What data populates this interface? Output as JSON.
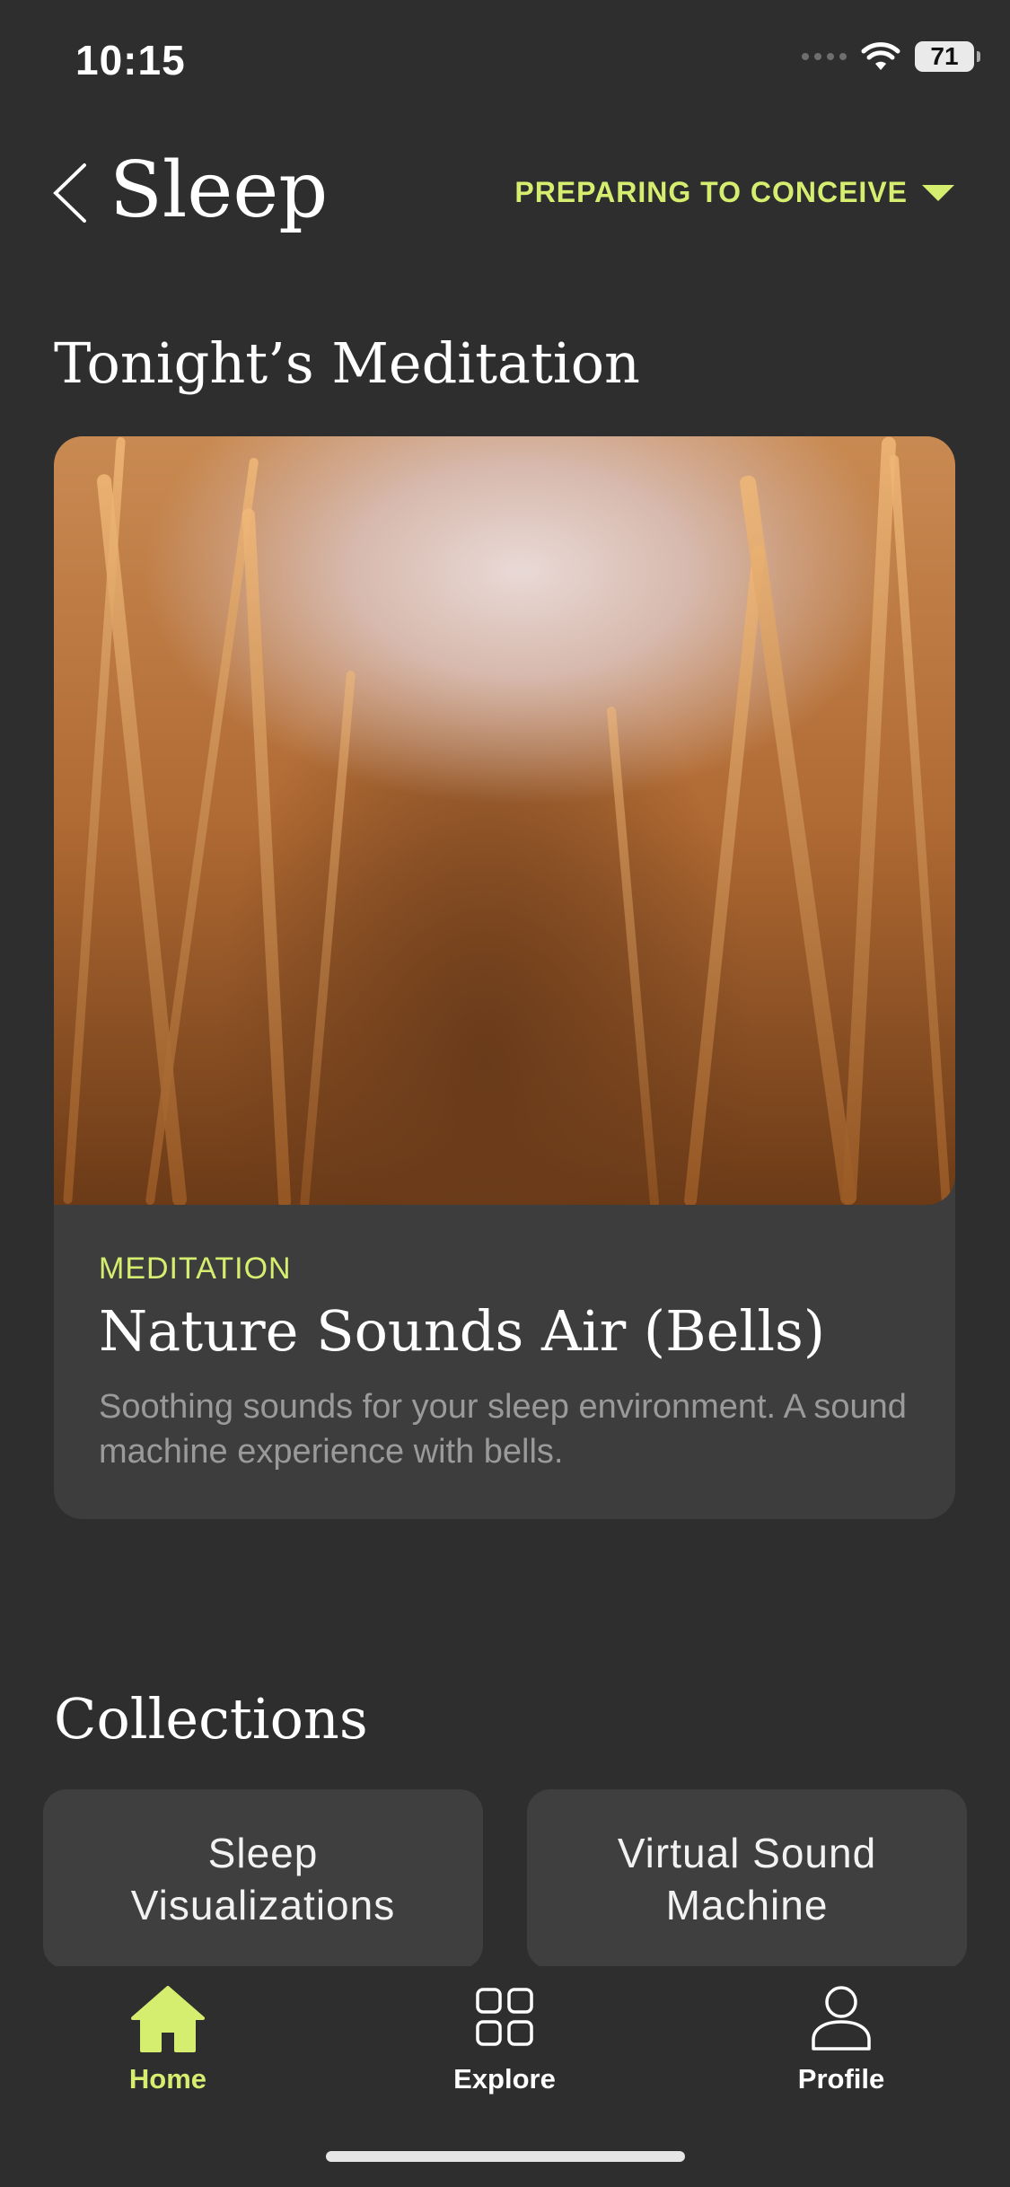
{
  "status": {
    "time": "10:15",
    "battery": "71"
  },
  "header": {
    "title": "Sleep",
    "stage": "PREPARING TO CONCEIVE"
  },
  "tonight": {
    "heading": "Tonight’s Meditation",
    "card": {
      "kind": "MEDITATION",
      "title": "Nature Sounds Air (Bells)",
      "description": "Soothing sounds for your sleep environment. A sound machine experience with bells."
    }
  },
  "collections": {
    "heading": "Collections",
    "items": [
      {
        "label": "Sleep Visualizations"
      },
      {
        "label": "Virtual Sound Machine"
      }
    ]
  },
  "tabs": [
    {
      "label": "Home",
      "icon": "home-icon",
      "active": true
    },
    {
      "label": "Explore",
      "icon": "grid-icon",
      "active": false
    },
    {
      "label": "Profile",
      "icon": "person-icon",
      "active": false
    }
  ],
  "colors": {
    "accent": "#d6ee6f",
    "background": "#2e2e2e",
    "card": "#3d3d3d"
  }
}
